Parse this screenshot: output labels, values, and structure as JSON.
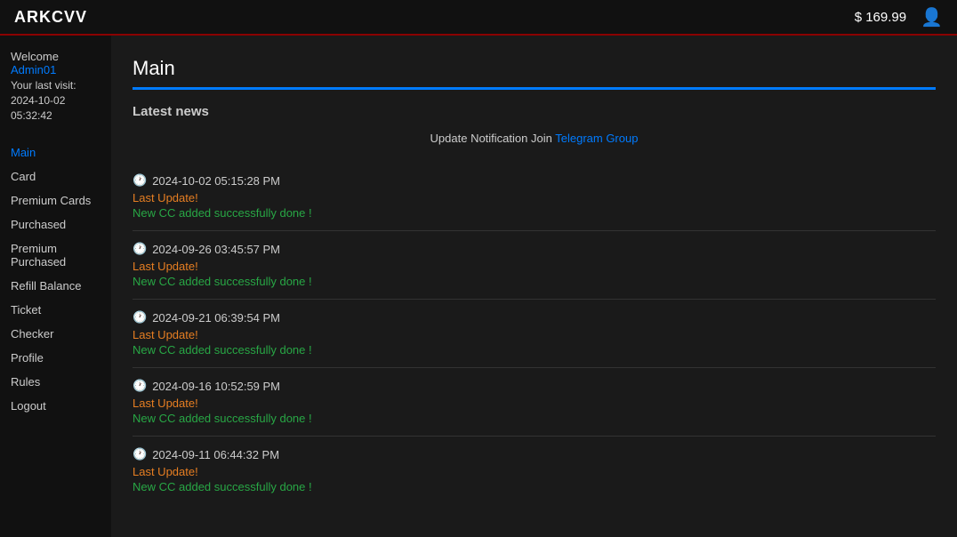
{
  "navbar": {
    "brand": "ARKCVV",
    "balance": "$ 169.99",
    "user_icon": "👤"
  },
  "sidebar": {
    "welcome_label": "Welcome",
    "username": "Admin01",
    "last_visit_label": "Your last visit:",
    "last_visit_date": "2024-10-02 05:32:42",
    "items": [
      {
        "label": "Main",
        "active": true
      },
      {
        "label": "Card",
        "active": false
      },
      {
        "label": "Premium Cards",
        "active": false
      },
      {
        "label": "Purchased",
        "active": false
      },
      {
        "label": "Premium Purchased",
        "active": false
      },
      {
        "label": "Refill Balance",
        "active": false
      },
      {
        "label": "Ticket",
        "active": false
      },
      {
        "label": "Checker",
        "active": false
      },
      {
        "label": "Profile",
        "active": false
      },
      {
        "label": "Rules",
        "active": false
      },
      {
        "label": "Logout",
        "active": false
      }
    ]
  },
  "main": {
    "title": "Main",
    "section_title": "Latest news",
    "notification_text": "Update Notification Join",
    "telegram_label": "Telegram Group",
    "news": [
      {
        "date": "2024-10-02 05:15:28 PM",
        "update_label": "Last Update!",
        "update_text": "New CC added successfully done !"
      },
      {
        "date": "2024-09-26 03:45:57 PM",
        "update_label": "Last Update!",
        "update_text": "New CC added successfully done !"
      },
      {
        "date": "2024-09-21 06:39:54 PM",
        "update_label": "Last Update!",
        "update_text": "New CC added successfully done !"
      },
      {
        "date": "2024-09-16 10:52:59 PM",
        "update_label": "Last Update!",
        "update_text": "New CC added successfully done !"
      },
      {
        "date": "2024-09-11 06:44:32 PM",
        "update_label": "Last Update!",
        "update_text": "New CC added successfully done !"
      }
    ]
  }
}
